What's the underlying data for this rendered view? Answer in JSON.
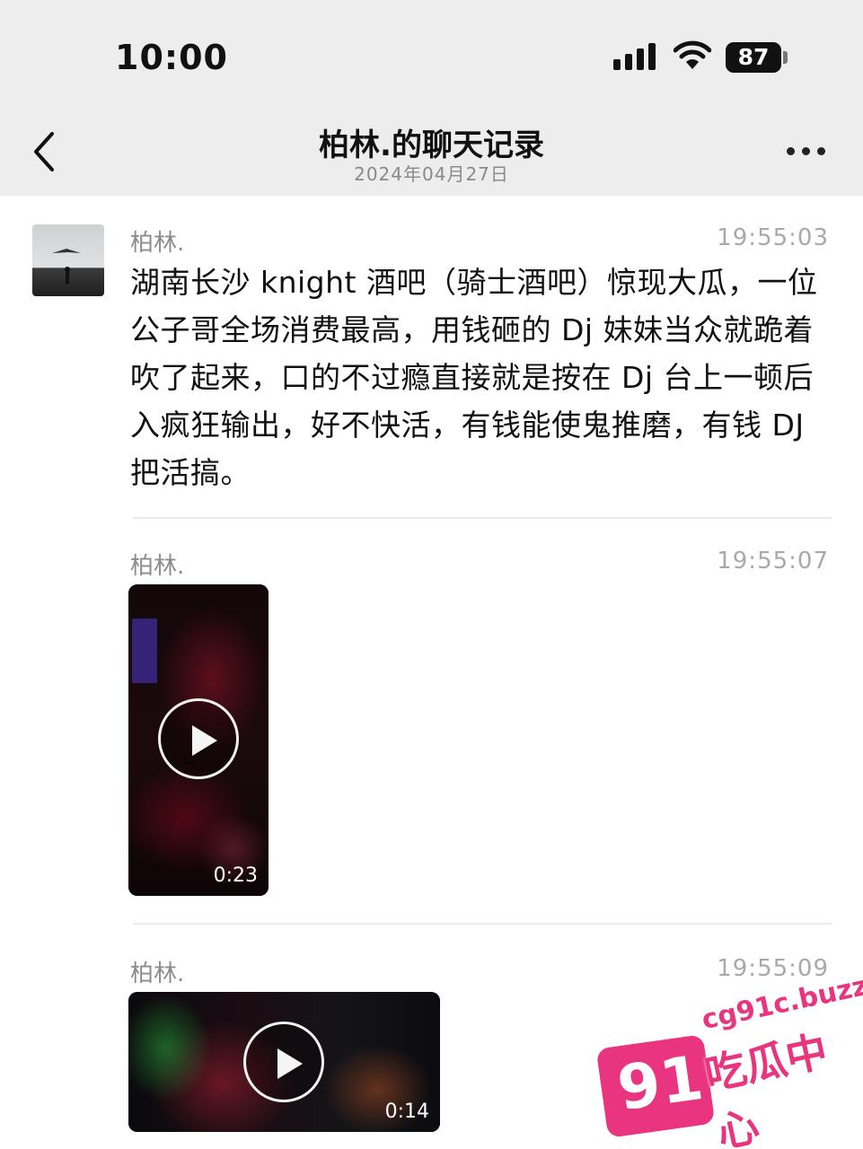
{
  "status_bar": {
    "time": "10:00",
    "battery": "87"
  },
  "nav": {
    "title": "柏林.的聊天记录",
    "subtitle": "2024年04月27日"
  },
  "messages": [
    {
      "sender": "柏林.",
      "time": "19:55:03",
      "text": "湖南长沙 knight 酒吧（骑士酒吧）惊现大瓜，一位公子哥全场消费最高，用钱砸的 Dj 妹妹当众就跪着吹了起来，口的不过瘾直接就是按在 Dj 台上一顿后入疯狂输出，好不快活，有钱能使鬼推磨，有钱 DJ 把活搞。"
    },
    {
      "sender": "柏林.",
      "time": "19:55:07",
      "video_duration": "0:23"
    },
    {
      "sender": "柏林.",
      "time": "19:55:09",
      "video_duration": "0:14"
    }
  ],
  "watermark": {
    "number": "91",
    "url": "cg91c.buzz",
    "name": "吃瓜中心"
  }
}
